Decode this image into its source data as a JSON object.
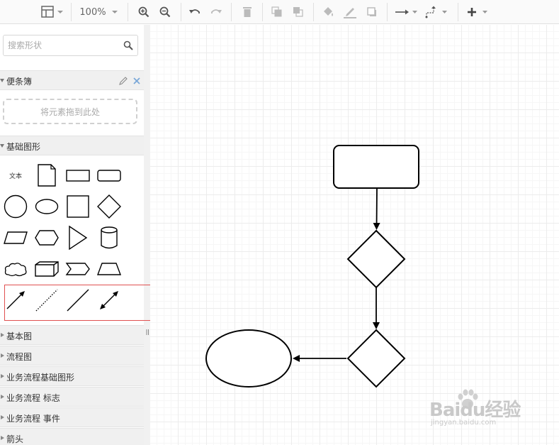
{
  "toolbar": {
    "zoom_level": "100%"
  },
  "sidebar": {
    "search": {
      "placeholder": "搜索形状"
    },
    "scratchpad": {
      "title": "便条簿",
      "drop_hint": "将元素拖到此处"
    },
    "basic_shapes": {
      "title": "基础图形",
      "text_shape_label": "文本"
    },
    "collapsed_sections": [
      {
        "label": "基本图"
      },
      {
        "label": "流程图"
      },
      {
        "label": "业务流程基础图形"
      },
      {
        "label": "业务流程 标志"
      },
      {
        "label": "业务流程 事件"
      },
      {
        "label": "箭头"
      }
    ]
  },
  "canvas": {
    "shapes": [
      "rounded-rectangle",
      "diamond",
      "diamond",
      "ellipse"
    ]
  },
  "watermark": {
    "brand": "Baidu经验",
    "url": "jingyan.baidu.com"
  },
  "colors": {
    "toolbar_bg": "#fafafa",
    "section_header_bg": "#f0f0f0",
    "highlight_border": "#e05050",
    "icon_color": "#666666"
  }
}
